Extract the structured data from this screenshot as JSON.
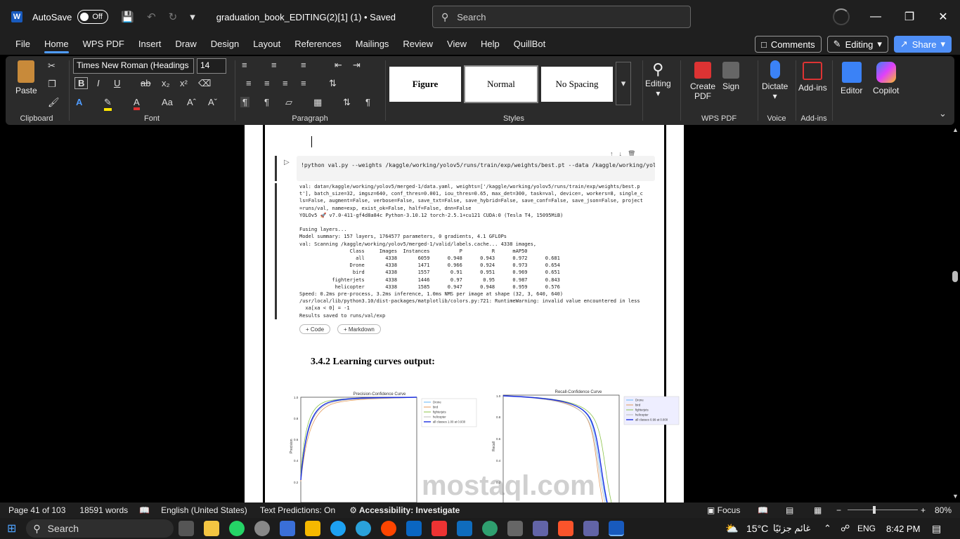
{
  "titlebar": {
    "autosave_label": "AutoSave",
    "toggle_label": "Off",
    "doc_title": "graduation_book_EDITING(2)[1] (1) • Saved",
    "search_placeholder": "Search"
  },
  "menu": [
    "File",
    "Home",
    "WPS PDF",
    "Insert",
    "Draw",
    "Design",
    "Layout",
    "References",
    "Mailings",
    "Review",
    "View",
    "Help",
    "QuillBot"
  ],
  "menu_right": {
    "comments": "Comments",
    "editing": "Editing",
    "share": "Share"
  },
  "ribbon": {
    "clipboard": {
      "paste": "Paste",
      "label": "Clipboard"
    },
    "font": {
      "family": "Times New Roman (Headings",
      "size": "14",
      "label": "Font"
    },
    "paragraph": {
      "label": "Paragraph"
    },
    "styles": {
      "items": [
        "Figure",
        "Normal",
        "No Spacing"
      ],
      "label": "Styles"
    },
    "editing": {
      "label": "Editing"
    },
    "wps": {
      "create": "Create PDF",
      "sign": "Sign",
      "label": "WPS PDF"
    },
    "voice": {
      "dictate": "Dictate",
      "label": "Voice"
    },
    "addins": {
      "item": "Add-ins",
      "label": "Add-ins"
    },
    "editor": "Editor",
    "copilot": "Copilot"
  },
  "doc": {
    "code_input": "!python val.py --weights /kaggle/working/yolov5/runs/train/exp/weights/best.pt --data /kaggle/working/yolov",
    "output_lines": [
      "val: data=/kaggle/working/yolov5/merged-1/data.yaml, weights=['/kaggle/working/yolov5/runs/train/exp/weights/best.p",
      "t'], batch_size=32, imgsz=640, conf_thres=0.001, iou_thres=0.65, max_det=300, task=val, device=, workers=8, single_c",
      "ls=False, augment=False, verbose=False, save_txt=False, save_hybrid=False, save_conf=False, save_json=False, project",
      "=runs/val, name=exp, exist_ok=False, half=False, dnn=False",
      "YOLOv5 🚀 v7.0-411-gf4d8a84c Python-3.10.12 torch-2.5.1+cu121 CUDA:0 (Tesla T4, 15095MiB)",
      "",
      "Fusing layers...",
      "Model summary: 157 layers, 1764577 parameters, 0 gradients, 4.1 GFLOPs",
      "val: Scanning /kaggle/working/yolov5/merged-1/valid/labels.cache... 4338 images,",
      "                 Class     Images  Instances          P          R      mAP50",
      "                   all       4338       6059      0.948      0.943      0.972      0.681",
      "                 Drone       4338       1471      0.966      0.924      0.973      0.654",
      "                  bird       4338       1557       0.91      0.951      0.969      0.651",
      "           fighterjets       4338       1446       0.97       0.95      0.987      0.843",
      "            helicopter       4338       1585      0.947      0.948      0.959      0.576",
      "Speed: 0.2ms pre-process, 3.2ms inference, 1.0ms NMS per image at shape (32, 3, 640, 640)",
      "/usr/local/lib/python3.10/dist-packages/matplotlib/colors.py:721: RuntimeWarning: invalid value encountered in less",
      "  xa[xa < 0] = -1",
      "Results saved to runs/val/exp"
    ],
    "code_btn": "+ Code",
    "markdown_btn": "+ Markdown",
    "heading": "3.4.2  Learning curves output:",
    "chart1": {
      "title": "Precision-Confidence Curve",
      "ylabel": "Precision",
      "legend": [
        "Drone",
        "bird",
        "fighterjets",
        "helicopter",
        "all classes 1.00 at 0.930"
      ]
    },
    "chart2": {
      "title": "Recall-Confidence Curve",
      "ylabel": "Recall",
      "legend": [
        "Drone",
        "bird",
        "fighterjets",
        "helicopter",
        "all classes 0.99 at 0.000"
      ]
    }
  },
  "status": {
    "page": "Page 41 of 103",
    "words": "18591 words",
    "lang": "English (United States)",
    "predictions": "Text Predictions: On",
    "accessibility": "Accessibility: Investigate",
    "focus": "Focus",
    "zoom": "80%"
  },
  "taskbar": {
    "search": "Search",
    "weather": "15°C",
    "weather_text": "غائم جزئيًا",
    "lang": "ENG",
    "time": "8:42 PM"
  },
  "watermark": "mostaql.com"
}
